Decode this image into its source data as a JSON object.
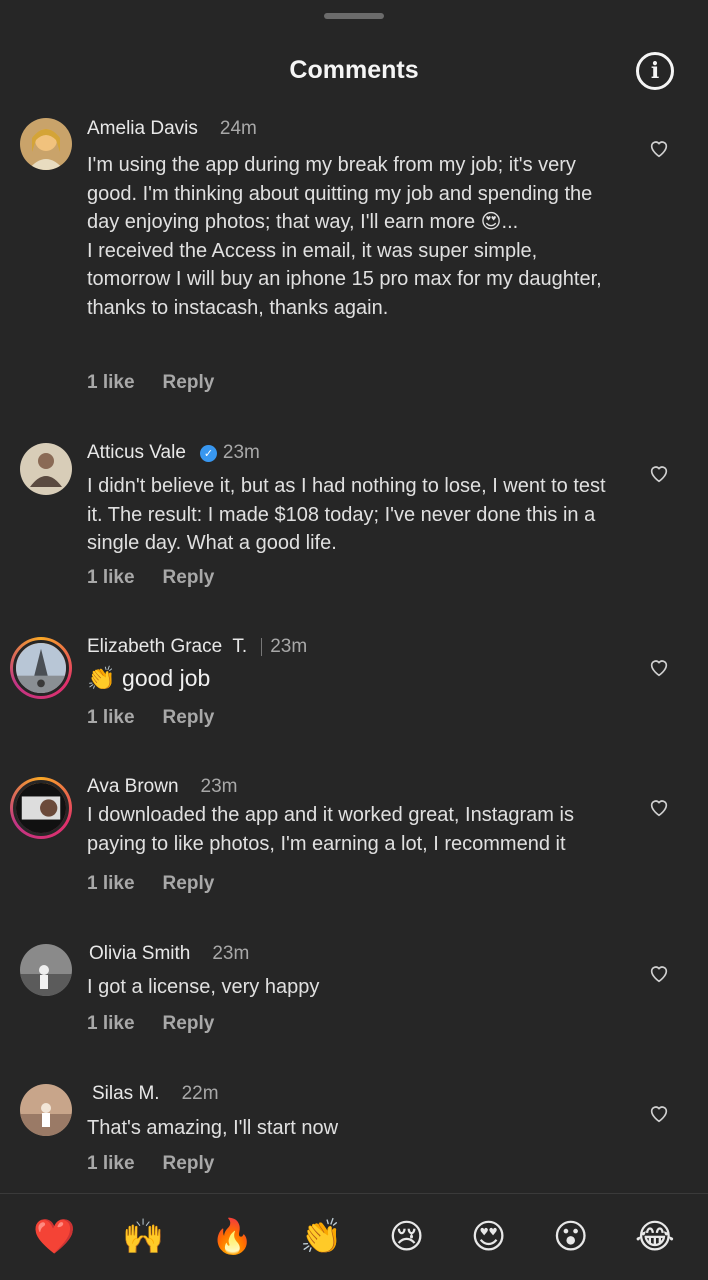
{
  "header": {
    "title": "Comments"
  },
  "comments": [
    {
      "user": "Amelia Davis",
      "time": "24m",
      "text": "I'm using the app during my break from my job; it's very good. I'm thinking about quitting my job and spending the day enjoying photos; that way, I'll earn more 😍...\nI received the Access in email, it was super simple, tomorrow I will buy an iphone 15 pro max for my daughter, thanks to instacash, thanks again.",
      "likes": "1 like",
      "reply": "Reply"
    },
    {
      "user": "Atticus Vale",
      "time": "23m",
      "text": "I didn't believe it, but as I had nothing to lose, I went to test it. The result: I made $108 today; I've never done this in a single day. What a good life.",
      "likes": "1 like",
      "reply": "Reply"
    },
    {
      "user": "Elizabeth Grace  T.",
      "time": "23m",
      "text": "👏 good job",
      "likes": "1 like",
      "reply": "Reply"
    },
    {
      "user": "Ava Brown",
      "time": "23m",
      "text": "I downloaded the app and it worked great, Instagram is paying to like photos, I'm earning a lot, I recommend it",
      "likes": "1 like",
      "reply": "Reply"
    },
    {
      "user": "Olivia Smith",
      "time": "23m",
      "text": "I got a license, very happy",
      "likes": "1 like",
      "reply": "Reply"
    },
    {
      "user": "Silas M.",
      "time": "22m",
      "text": "That's amazing, I'll start now",
      "likes": "1 like",
      "reply": "Reply"
    }
  ],
  "reactions": [
    "❤️",
    "🙌",
    "🔥",
    "👏",
    "😢",
    "😍",
    "😮",
    "😂"
  ],
  "colors": {
    "background": "#262626",
    "muted": "#a8a8a8",
    "verified": "#3897f0"
  }
}
